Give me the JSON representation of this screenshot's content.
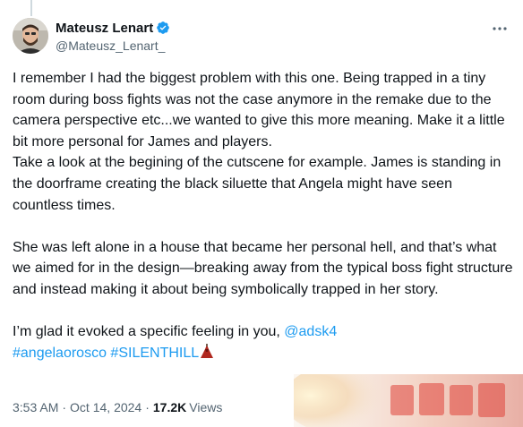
{
  "author": {
    "display_name": "Mateusz Lenart",
    "handle": "@Mateusz_Lenart_",
    "verified": true
  },
  "tweet": {
    "paragraph1": "I remember I had the biggest problem with this one. Being trapped in a tiny room during boss fights was not the case anymore in the remake due to the camera perspective etc...we wanted to give this more meaning. Make it a little bit more personal for James and players.\nTake a look at the begining of the cutscene for example. James is standing in the doorframe creating the black siluette that Angela might have seen countless times.",
    "paragraph2": "She was left alone in a house that became her personal hell, and that’s what we aimed for in the design—breaking away from the typical boss fight structure and instead making it about being symbolically trapped in her story.",
    "paragraph3_prefix": "I’m glad it evoked a specific feeling in you, ",
    "mention": "@adsk4",
    "hashtag1": "#angelaorosco",
    "hashtag2": "#SILENTHILL",
    "emoji_icon": "red-dress-pyramid-head-emoji"
  },
  "meta": {
    "time": "3:53 AM",
    "separator": "·",
    "date": "Oct 14, 2024",
    "views_count": "17.2K",
    "views_label": "Views"
  },
  "icons": {
    "more": "more-horizontal-icon",
    "verified": "verified-badge-icon"
  },
  "colors": {
    "link": "#1d9bf0",
    "secondary_text": "#536471",
    "primary_text": "#0f1419",
    "verified": "#1d9bf0"
  }
}
